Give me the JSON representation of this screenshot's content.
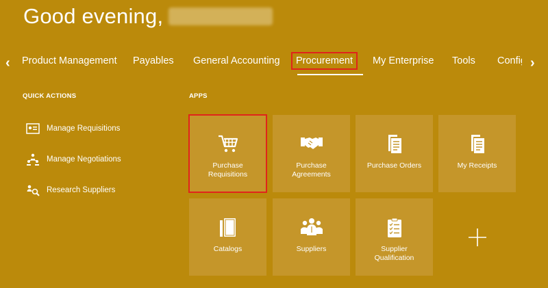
{
  "greeting": "Good evening,",
  "nav": {
    "tabs": [
      "Product Management",
      "Payables",
      "General Accounting",
      "Procurement",
      "My Enterprise",
      "Tools",
      "Config"
    ],
    "selected": "Procurement"
  },
  "quick_actions": {
    "title": "QUICK ACTIONS",
    "items": [
      "Manage Requisitions",
      "Manage Negotiations",
      "Research Suppliers"
    ]
  },
  "apps": {
    "title": "APPS",
    "tiles": [
      {
        "line1": "Purchase",
        "line2": "Requisitions",
        "icon": "shopping-cart-icon"
      },
      {
        "line1": "Purchase",
        "line2": "Agreements",
        "icon": "handshake-icon"
      },
      {
        "line1": "Purchase Orders",
        "line2": "",
        "icon": "documents-icon"
      },
      {
        "line1": "My Receipts",
        "line2": "",
        "icon": "receipt-icon"
      },
      {
        "line1": "Catalogs",
        "line2": "",
        "icon": "catalog-icon"
      },
      {
        "line1": "Suppliers",
        "line2": "",
        "icon": "suppliers-icon"
      },
      {
        "line1": "Supplier",
        "line2": "Qualification",
        "icon": "checklist-icon"
      }
    ]
  },
  "colors": {
    "background": "#bb8a0b",
    "tile": "#c5962a",
    "highlight": "#e0241b"
  }
}
